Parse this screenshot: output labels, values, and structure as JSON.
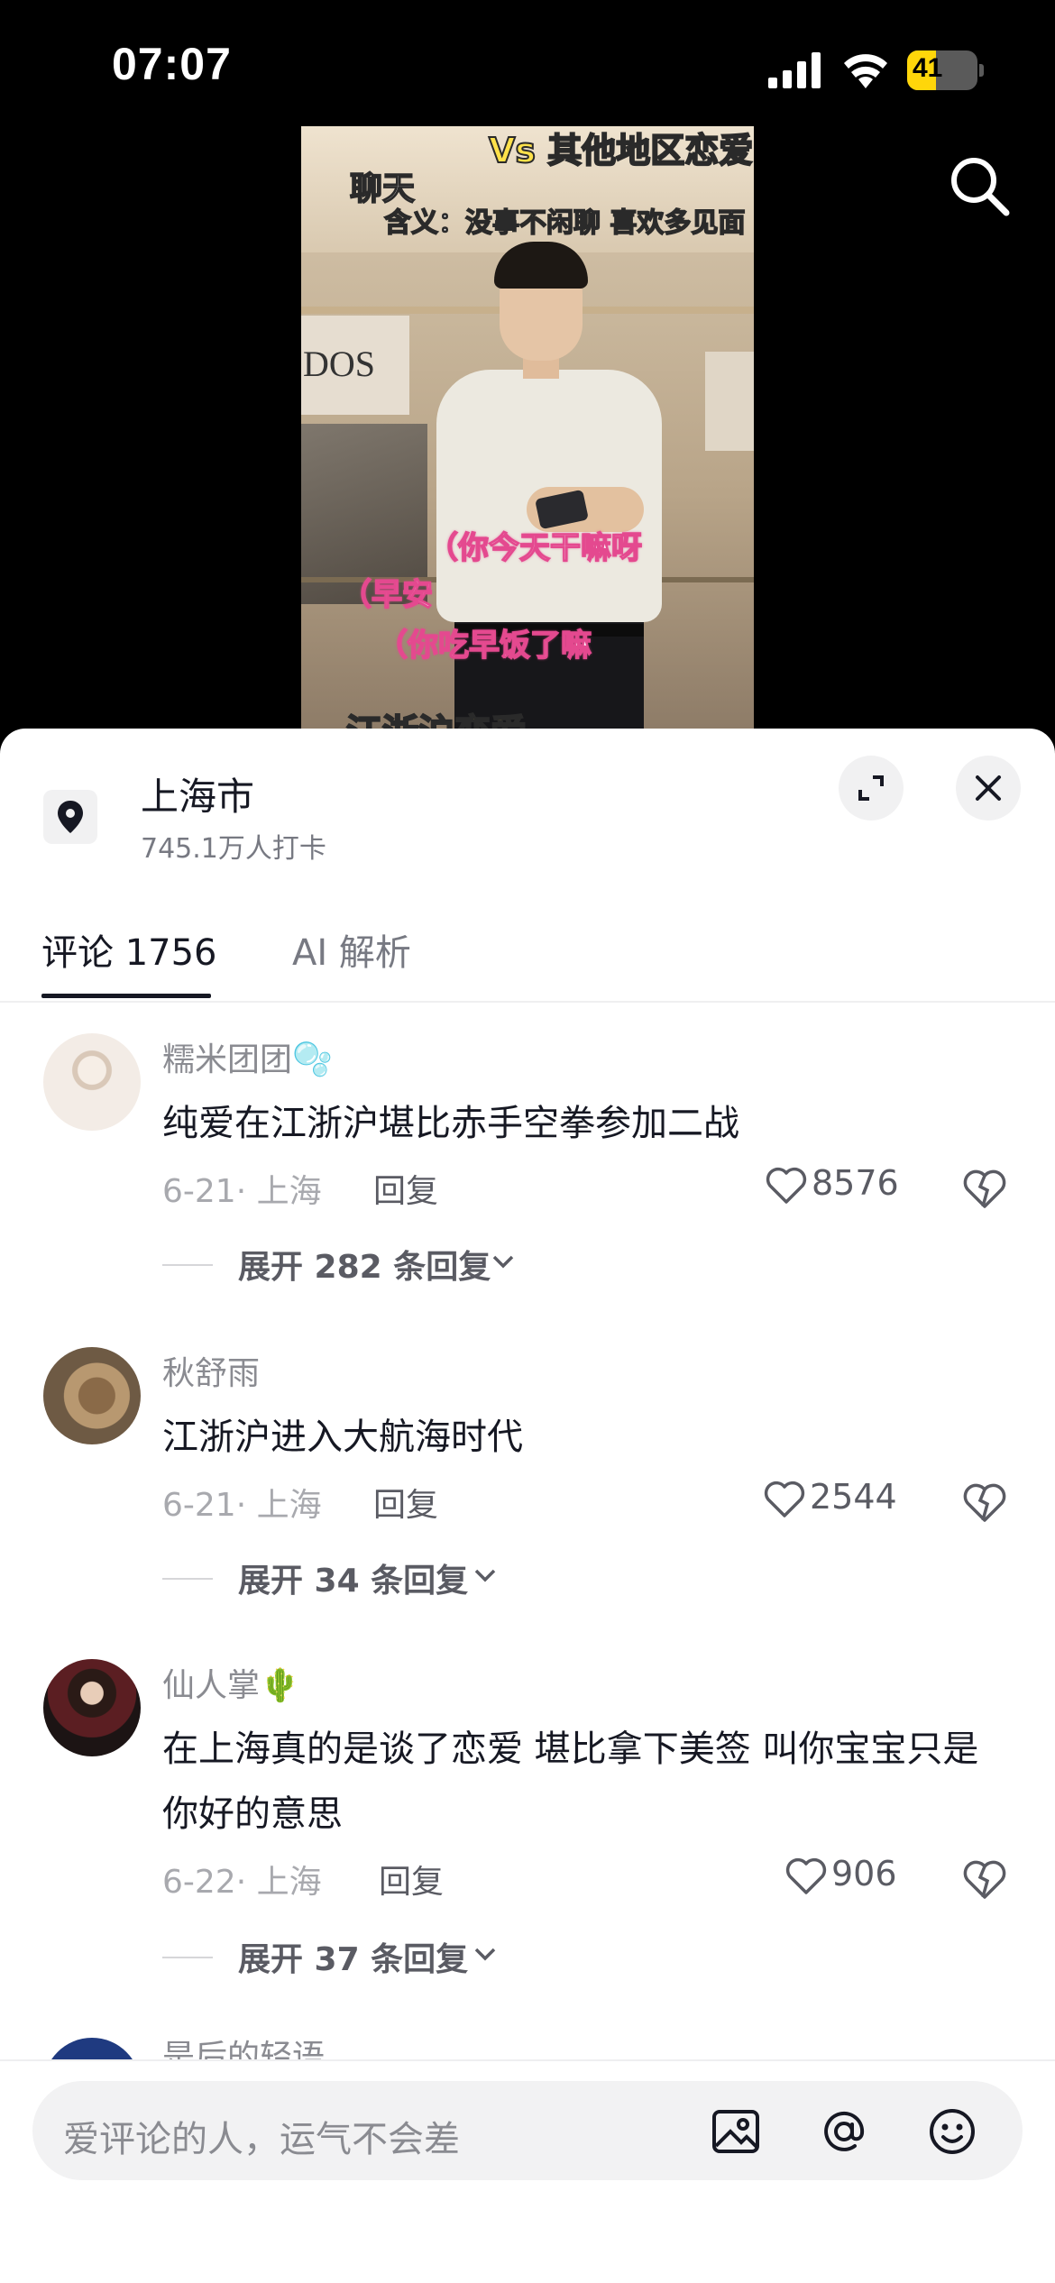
{
  "status_bar": {
    "time": "07:07",
    "battery": "41"
  },
  "video": {
    "caption_top": "Vs 其他地区恋爱",
    "caption_title": "聊天",
    "caption_meaning": "含义：没事不闲聊 喜欢多见面",
    "store_sign": "DOS",
    "bubbles": [
      "（你今天干嘛呀",
      "（早安",
      "（你吃早饭了嘛"
    ],
    "caption_bottom": "江浙沪恋爱"
  },
  "location": {
    "title": "上海市",
    "subtitle": "745.1万人打卡"
  },
  "tabs": [
    {
      "label": "评论 1756",
      "active": true
    },
    {
      "label": "AI 解析",
      "active": false
    }
  ],
  "comments": [
    {
      "user": "糯米团团🫧",
      "text": "纯爱在江浙沪堪比赤手空拳参加二战",
      "meta": "6-21· 上海",
      "reply": "回复",
      "likes": "8576",
      "expand": "展开 282 条回复"
    },
    {
      "user": "秋舒雨",
      "text": "江浙沪进入大航海时代",
      "meta": "6-21· 上海",
      "reply": "回复",
      "likes": "2544",
      "expand": "展开 34 条回复"
    },
    {
      "user": "仙人掌🌵",
      "text": "在上海真的是谈了恋爱  堪比拿下美签  叫你宝宝只是你好的意思",
      "meta": "6-22· 上海",
      "reply": "回复",
      "likes": "906",
      "expand": "展开 37 条回复"
    },
    {
      "user": "是后的轻语"
    }
  ],
  "input": {
    "placeholder": "爱评论的人，运气不会差"
  },
  "icons": {
    "search": "search-icon",
    "location": "location-pin-icon",
    "expand": "expand-icon",
    "close": "close-icon",
    "like": "heart-icon",
    "dislike": "broken-heart-icon",
    "image": "image-icon",
    "mention": "at-icon",
    "emoji": "emoji-icon"
  }
}
